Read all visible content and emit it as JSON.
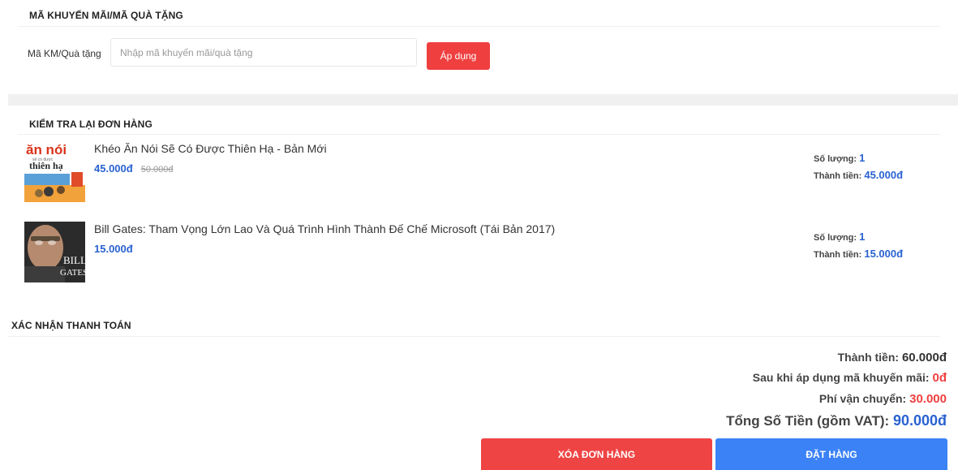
{
  "promo": {
    "section_title": "MÃ KHUYẾN MÃI/MÃ QUÀ TẶNG",
    "label": "Mã KM/Quà tặng",
    "placeholder": "Nhập mã khuyến mãi/quà tặng",
    "value": "",
    "apply_label": "Áp dụng"
  },
  "order": {
    "section_title": "KIỂM TRA LẠI ĐƠN HÀNG",
    "qty_label": "Số lượng:",
    "subtotal_label": "Thành tiền:",
    "items": [
      {
        "name": "Khéo Ăn Nói Sẽ Có Được Thiên Hạ - Bản Mới",
        "price": "45.000đ",
        "old_price": "50.000đ",
        "quantity": "1",
        "subtotal": "45.000đ",
        "cover_text": [
          "ăn nói",
          "thiên hạ"
        ]
      },
      {
        "name": "Bill Gates: Tham Vọng Lớn Lao Và Quá Trình Hình Thành Đế Chế Microsoft (Tái Bản 2017)",
        "price": "15.000đ",
        "quantity": "1",
        "subtotal": "15.000đ",
        "cover_text": [
          "BILL",
          "GATES"
        ]
      }
    ]
  },
  "payment": {
    "section_title": "XÁC NHẬN THANH TOÁN",
    "subtotal_label": "Thành tiền:",
    "subtotal_value": "60.000đ",
    "discount_label": "Sau khi áp dụng mã khuyến mãi:",
    "discount_value": "0đ",
    "shipping_label": "Phí vận chuyển:",
    "shipping_value": "30.000",
    "total_label": "Tổng Số Tiền (gồm VAT):",
    "total_value": "90.000đ",
    "delete_label": "XÓA ĐƠN HÀNG",
    "order_label": "ĐẶT HÀNG"
  },
  "colors": {
    "red": "#ef4444",
    "blue": "#3b82f6",
    "price_blue": "#2a62d1"
  }
}
